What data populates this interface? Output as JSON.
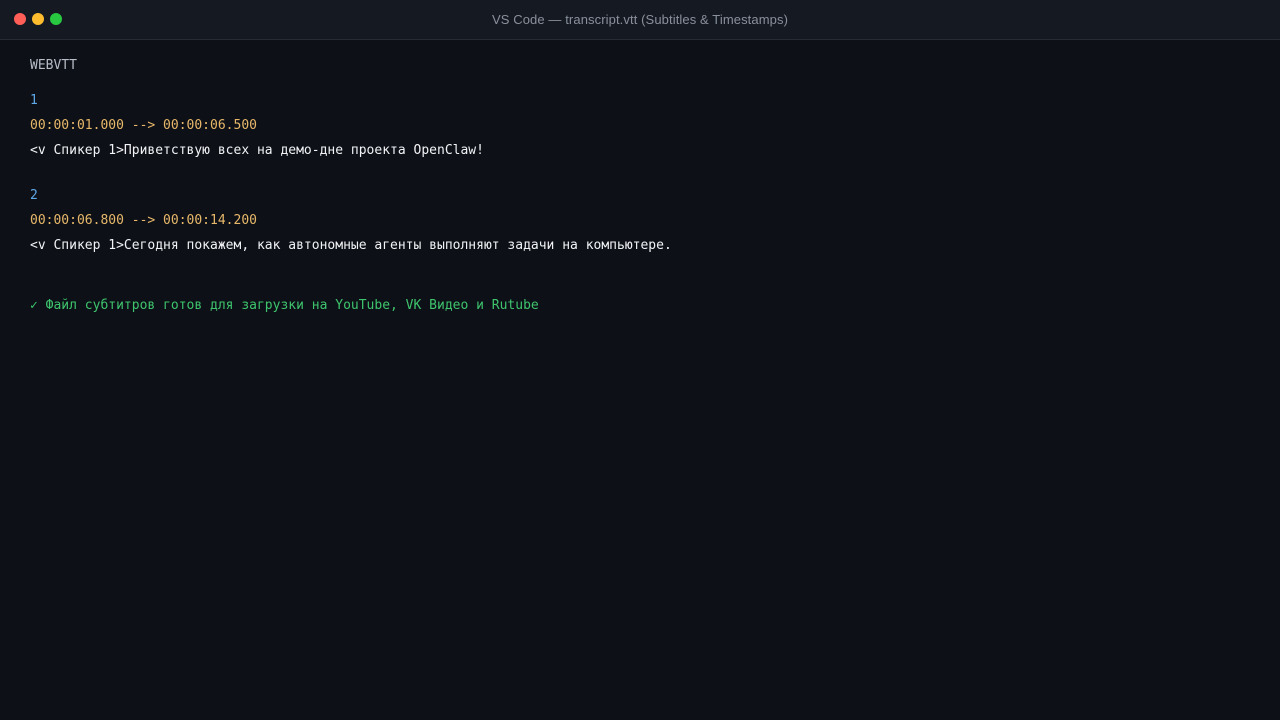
{
  "window": {
    "title": "VS Code — transcript.vtt (Subtitles & Timestamps)"
  },
  "editor": {
    "header": "WEBVTT",
    "cues": [
      {
        "id": "1",
        "timing": "00:00:01.000 --> 00:00:06.500",
        "text": "<v Спикер 1>Приветствую всех на демо-дне проекта OpenClaw!"
      },
      {
        "id": "2",
        "timing": "00:00:06.800 --> 00:00:14.200",
        "text": "<v Спикер 1>Сегодня покажем, как автономные агенты выполняют задачи на компьютере."
      }
    ],
    "status": "✓ Файл субтитров готов для загрузки на YouTube, VK Видео и Rutube"
  },
  "colors": {
    "background": "#0d1017",
    "cue_id": "#5fa8e8",
    "timestamp": "#e8b86a",
    "text": "#f1f3f6",
    "success": "#3ec46d"
  }
}
